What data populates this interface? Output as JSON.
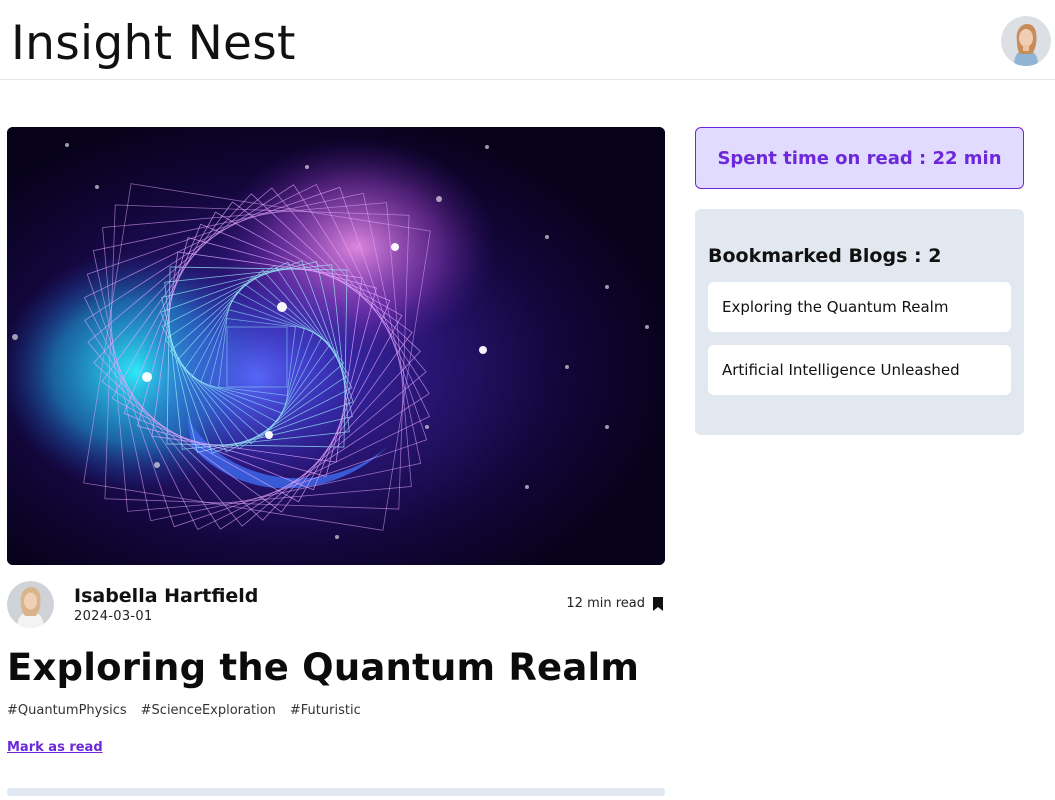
{
  "header": {
    "brand": "Insight Nest",
    "user_avatar_icon": "user-portrait-icon"
  },
  "post": {
    "cover_image": "quantum-spiral-cover-image",
    "author": "Isabella Hartfield",
    "date": "2024-03-01",
    "read_time": "12 min read",
    "bookmark_icon": "bookmark-icon",
    "title": "Exploring the Quantum Realm",
    "tags": [
      "#QuantumPhysics",
      "#ScienceExploration",
      "#Futuristic"
    ],
    "mark_as_read": "Mark as read"
  },
  "sidebar": {
    "spent_time": "Spent time on read : 22 min",
    "bookmarks_title": "Bookmarked Blogs : 2",
    "bookmarks": [
      "Exploring the Quantum Realm",
      "Artificial Intelligence Unleashed"
    ]
  },
  "colors": {
    "accent": "#6d28d9",
    "accent_bg": "#e0dbff",
    "panel_bg": "#e2e8f0"
  }
}
